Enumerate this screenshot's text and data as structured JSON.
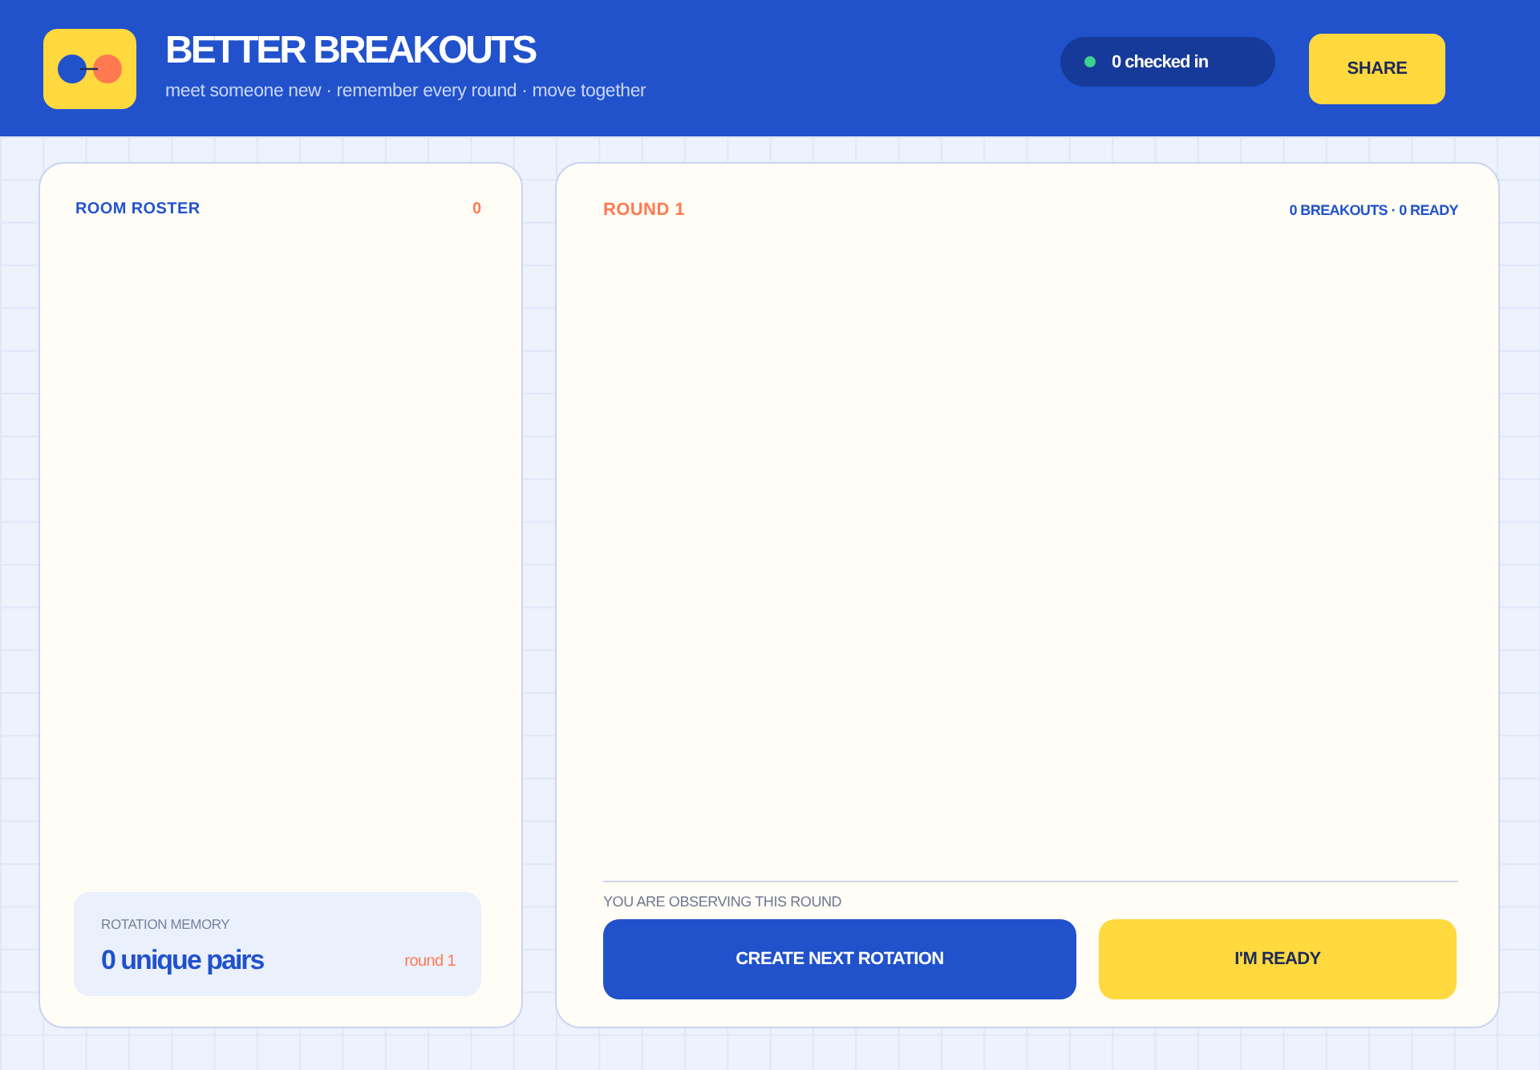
{
  "header": {
    "title": "BETTER BREAKOUTS",
    "tagline": "meet someone new · remember every round · move together",
    "checked_in": "0 checked in",
    "share_button": "SHARE"
  },
  "roster": {
    "title": "ROOM ROSTER",
    "count": "0"
  },
  "rotation_memory": {
    "label": "ROTATION MEMORY",
    "value": "0 unique pairs",
    "round": "round 1"
  },
  "round": {
    "title": "ROUND 1",
    "summary": "0 BREAKOUTS · 0 READY",
    "status": "YOU ARE OBSERVING THIS ROUND",
    "buttons": [
      {
        "label": "CREATE NEXT ROTATION",
        "kind": "primary"
      },
      {
        "label": "I'M READY",
        "kind": "accent"
      }
    ]
  }
}
